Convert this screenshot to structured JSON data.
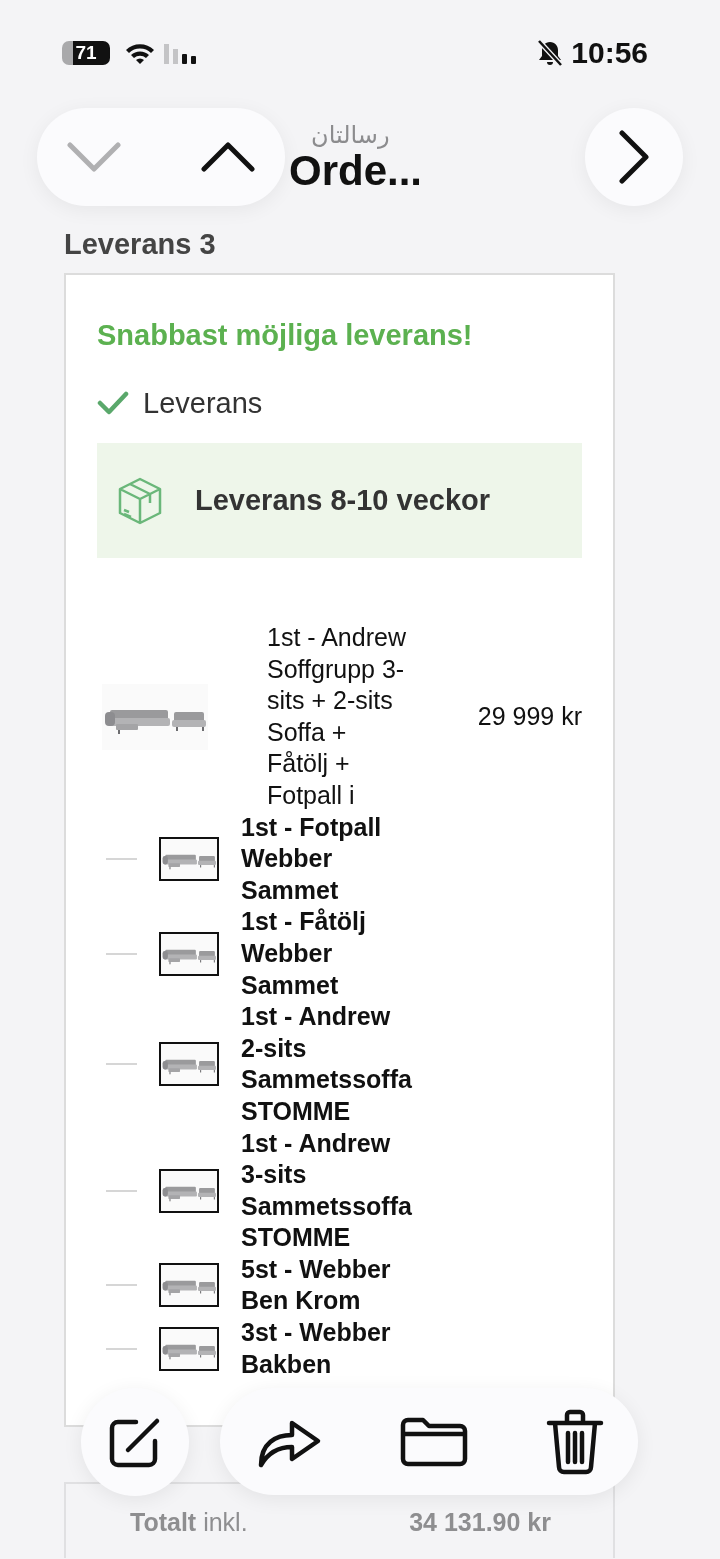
{
  "status_bar": {
    "battery": "71",
    "time": "10:56"
  },
  "nav": {
    "subtitle": "رسالتان",
    "title": "Orde..."
  },
  "delivery": {
    "heading": "Leverans 3",
    "promo": "Snabbast möjliga leverans!",
    "option": {
      "label": "Leverans",
      "checked": true
    },
    "estimate": "Leverans 8-10 veckor",
    "product": {
      "name": "1st - Andrew Soffgrupp 3-sits + 2-sits Soffa + Fåtölj + Fotpall i",
      "price": "29 999 kr"
    },
    "components": [
      {
        "name": "1st - Fotpall Webber Sammet"
      },
      {
        "name": "1st - Fåtölj Webber Sammet"
      },
      {
        "name": "1st - Andrew 2-sits Sammetssoffa STOMME"
      },
      {
        "name": "1st - Andrew 3-sits Sammetssoffa STOMME"
      },
      {
        "name": "5st - Webber Ben Krom"
      },
      {
        "name": "3st - Webber Bakben"
      }
    ]
  },
  "totals": {
    "label": "**Totalt** inkl.",
    "amount": "34 131.90 kr"
  }
}
